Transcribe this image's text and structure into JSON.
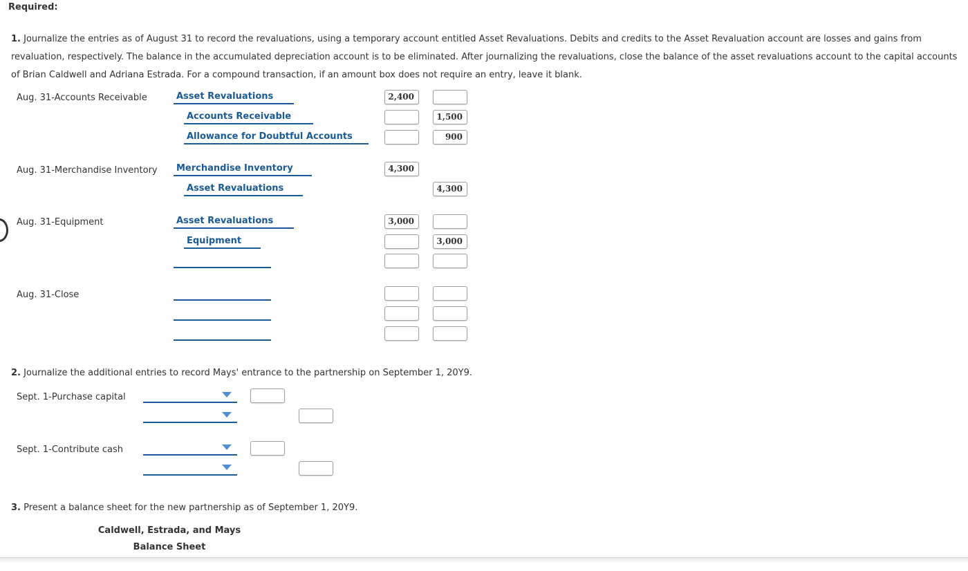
{
  "required_label": "Required:",
  "q1": {
    "number": "1.",
    "text": "Journalize the entries as of August 31 to record the revaluations, using a temporary account entitled Asset Revaluations. Debits and credits to the Asset Revaluation account are losses and gains from revaluation, respectively. The balance in the accumulated depreciation account is to be eliminated. After journalizing the revaluations, close the balance of the asset revaluations account to the capital accounts of Brian Caldwell and Adriana Estrada. For a compound transaction, if an amount box does not require an entry, leave it blank.",
    "entries": [
      {
        "label": "Aug. 31-Accounts Receivable",
        "lines": [
          {
            "account": "Asset Revaluations",
            "debit": "2,400",
            "credit": ""
          },
          {
            "account": "Accounts Receivable",
            "debit": "",
            "credit": "1,500"
          },
          {
            "account": "Allowance for Doubtful Accounts",
            "debit": "",
            "credit": "900"
          }
        ]
      },
      {
        "label": "Aug. 31-Merchandise Inventory",
        "lines": [
          {
            "account": "Merchandise Inventory",
            "debit": "4,300"
          },
          {
            "account": "Asset Revaluations",
            "credit": "4,300"
          }
        ]
      },
      {
        "label": "Aug. 31-Equipment",
        "lines": [
          {
            "account": "Asset Revaluations",
            "debit": "3,000",
            "credit": ""
          },
          {
            "account": "Equipment",
            "debit": "",
            "credit": "3,000"
          },
          {
            "account": "",
            "debit": "",
            "credit": ""
          }
        ]
      },
      {
        "label": "Aug. 31-Close",
        "lines": [
          {
            "account": "",
            "debit": "",
            "credit": ""
          },
          {
            "account": "",
            "debit": "",
            "credit": ""
          },
          {
            "account": "",
            "debit": "",
            "credit": ""
          }
        ]
      }
    ]
  },
  "q2": {
    "number": "2.",
    "text": "Journalize the additional entries to record Mays' entrance to the partnership on September 1, 20Y9.",
    "entries": [
      {
        "label": "Sept. 1-Purchase capital",
        "lines": [
          {
            "account": "",
            "debit": ""
          },
          {
            "account": "",
            "credit": ""
          }
        ]
      },
      {
        "label": "Sept. 1-Contribute cash",
        "lines": [
          {
            "account": "",
            "debit": ""
          },
          {
            "account": "",
            "credit": ""
          }
        ]
      }
    ]
  },
  "q3": {
    "number": "3.",
    "text": "Present a balance sheet for the new partnership as of September 1, 20Y9.",
    "company": "Caldwell, Estrada, and Mays",
    "statement": "Balance Sheet"
  },
  "colors": {
    "account_link": "#1a5a96",
    "dropdown_arrow": "#4f8fcf"
  }
}
